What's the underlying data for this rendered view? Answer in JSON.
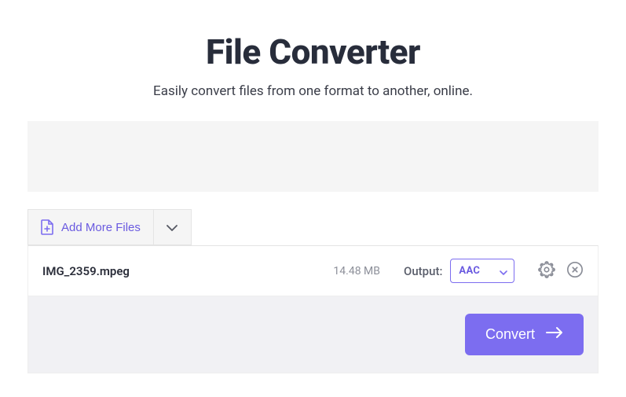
{
  "header": {
    "title": "File Converter",
    "subtitle": "Easily convert files from one format to another, online."
  },
  "toolbar": {
    "add_more_label": "Add More Files"
  },
  "file": {
    "name": "IMG_2359.mpeg",
    "size": "14.48 MB",
    "output_label": "Output:",
    "output_format": "AAC"
  },
  "actions": {
    "convert_label": "Convert"
  },
  "colors": {
    "accent": "#7c6df0",
    "text_dark": "#282d3b",
    "text_muted": "#8c8f99",
    "bg_light": "#f5f5f5"
  }
}
